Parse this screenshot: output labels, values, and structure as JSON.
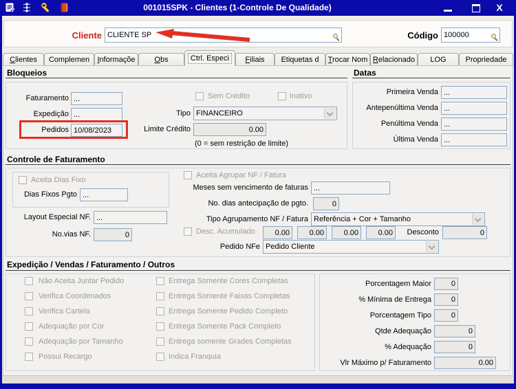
{
  "colors": {
    "titlebar": "#0b0baa",
    "annotation_red": "#e23024",
    "cliente_label_red": "#cf241c",
    "field_border_blue": "#89a7c6"
  },
  "window": {
    "title": "001015SPK - Clientes (1-Controle De Qualidade)",
    "close_label": "X",
    "toolbar_icons": [
      "form-icon",
      "traffic-light-icon",
      "wrench-icon",
      "book-icon"
    ]
  },
  "header": {
    "cliente_label": "Cliente",
    "cliente_value": "CLIENTE SP",
    "codigo_label": "Código",
    "codigo_value": "100000"
  },
  "tabs": {
    "active_index": 4,
    "items": [
      "Clientes",
      "Complemen",
      "Informaçõe",
      "Obs",
      "Ctrl. Especi",
      "Filiais",
      "Etiquetas d",
      "Trocar Nom",
      "Relacionado",
      "LOG",
      "Propriedade"
    ]
  },
  "bloqueios": {
    "title": "Bloqueios",
    "faturamento": {
      "label": "Faturamento",
      "value": "..."
    },
    "expedicao": {
      "label": "Expedição",
      "value": "..."
    },
    "pedidos": {
      "label": "Pedidos",
      "value": "10/08/2023"
    },
    "sem_credito": {
      "label": "Sem Crédito",
      "checked": false
    },
    "inativo": {
      "label": "Inativo",
      "checked": false
    },
    "tipo": {
      "label": "Tipo",
      "value": "FINANCEIRO"
    },
    "limite_credito": {
      "label": "Limite Crédito",
      "value": "0.00"
    },
    "hint": "(0 = sem restrição de limite)"
  },
  "datas": {
    "title": "Datas",
    "rows": [
      {
        "label": "Primeira Venda",
        "value": "..."
      },
      {
        "label": "Antepenúltima Venda",
        "value": "..."
      },
      {
        "label": "Penúltima Venda",
        "value": "..."
      },
      {
        "label": "Última Venda",
        "value": "..."
      }
    ]
  },
  "controle": {
    "title": "Controle de Faturamento",
    "aceita_dias_fixo": {
      "label": "Aceita Dias Fixo",
      "checked": false
    },
    "dias_fixos_pgto": {
      "label": "Dias Fixos Pgto",
      "value": "..."
    },
    "layout_especial": {
      "label": "Layout Especial NF.",
      "value": "..."
    },
    "no_vias": {
      "label": "No.vias NF.",
      "value": "0"
    },
    "aceita_agrupar": {
      "label": "Aceita Agrupar NF / Fatura",
      "checked": false
    },
    "meses_sem_vencimento": {
      "label": "Meses sem vencimento de faturas",
      "value": "..."
    },
    "dias_antecipacao": {
      "label": "No. dias antecipação de pgto.",
      "value": "0"
    },
    "tipo_agrupamento": {
      "label": "Tipo Agrupamento NF / Fatura",
      "value": "Referência + Cor + Tamanho"
    },
    "desc_acumulado": {
      "label": "Desc. Acumulado",
      "checked": false,
      "values": [
        "0.00",
        "0.00",
        "0.00",
        "0.00"
      ]
    },
    "desconto": {
      "label": "Desconto",
      "value": "0"
    },
    "pedido_nfe": {
      "label": "Pedido NFe",
      "value": "Pedido Cliente"
    }
  },
  "expedicao_outros": {
    "title": "Expedição / Vendas / Faturamento / Outros",
    "col1": [
      "Não Aceita Juntar Pedido",
      "Verifica Coordenados",
      "Verifica Cartela",
      "Adequação por Cor",
      "Adequação por Tamanho",
      "Possui Recargo"
    ],
    "col2": [
      "Entrega Somente Cores Completas",
      "Entrega Somente Faixas Completas",
      "Entrega Somente Pedido Completo",
      "Entrega Somente Pack Completo",
      "Entrega somente Grades Completas",
      "Indica Franquia"
    ],
    "fields": [
      {
        "label": "Porcentagem Maior",
        "value": "0"
      },
      {
        "label": "% Mínima de Entrega",
        "value": "0"
      },
      {
        "label": "Porcentagem Tipo",
        "value": "0"
      },
      {
        "label": "Qtde Adequação",
        "value": "0"
      },
      {
        "label": "% Adequação",
        "value": "0"
      },
      {
        "label": "Vlr Máximo p/ Faturamento",
        "value": "0.00"
      }
    ]
  }
}
